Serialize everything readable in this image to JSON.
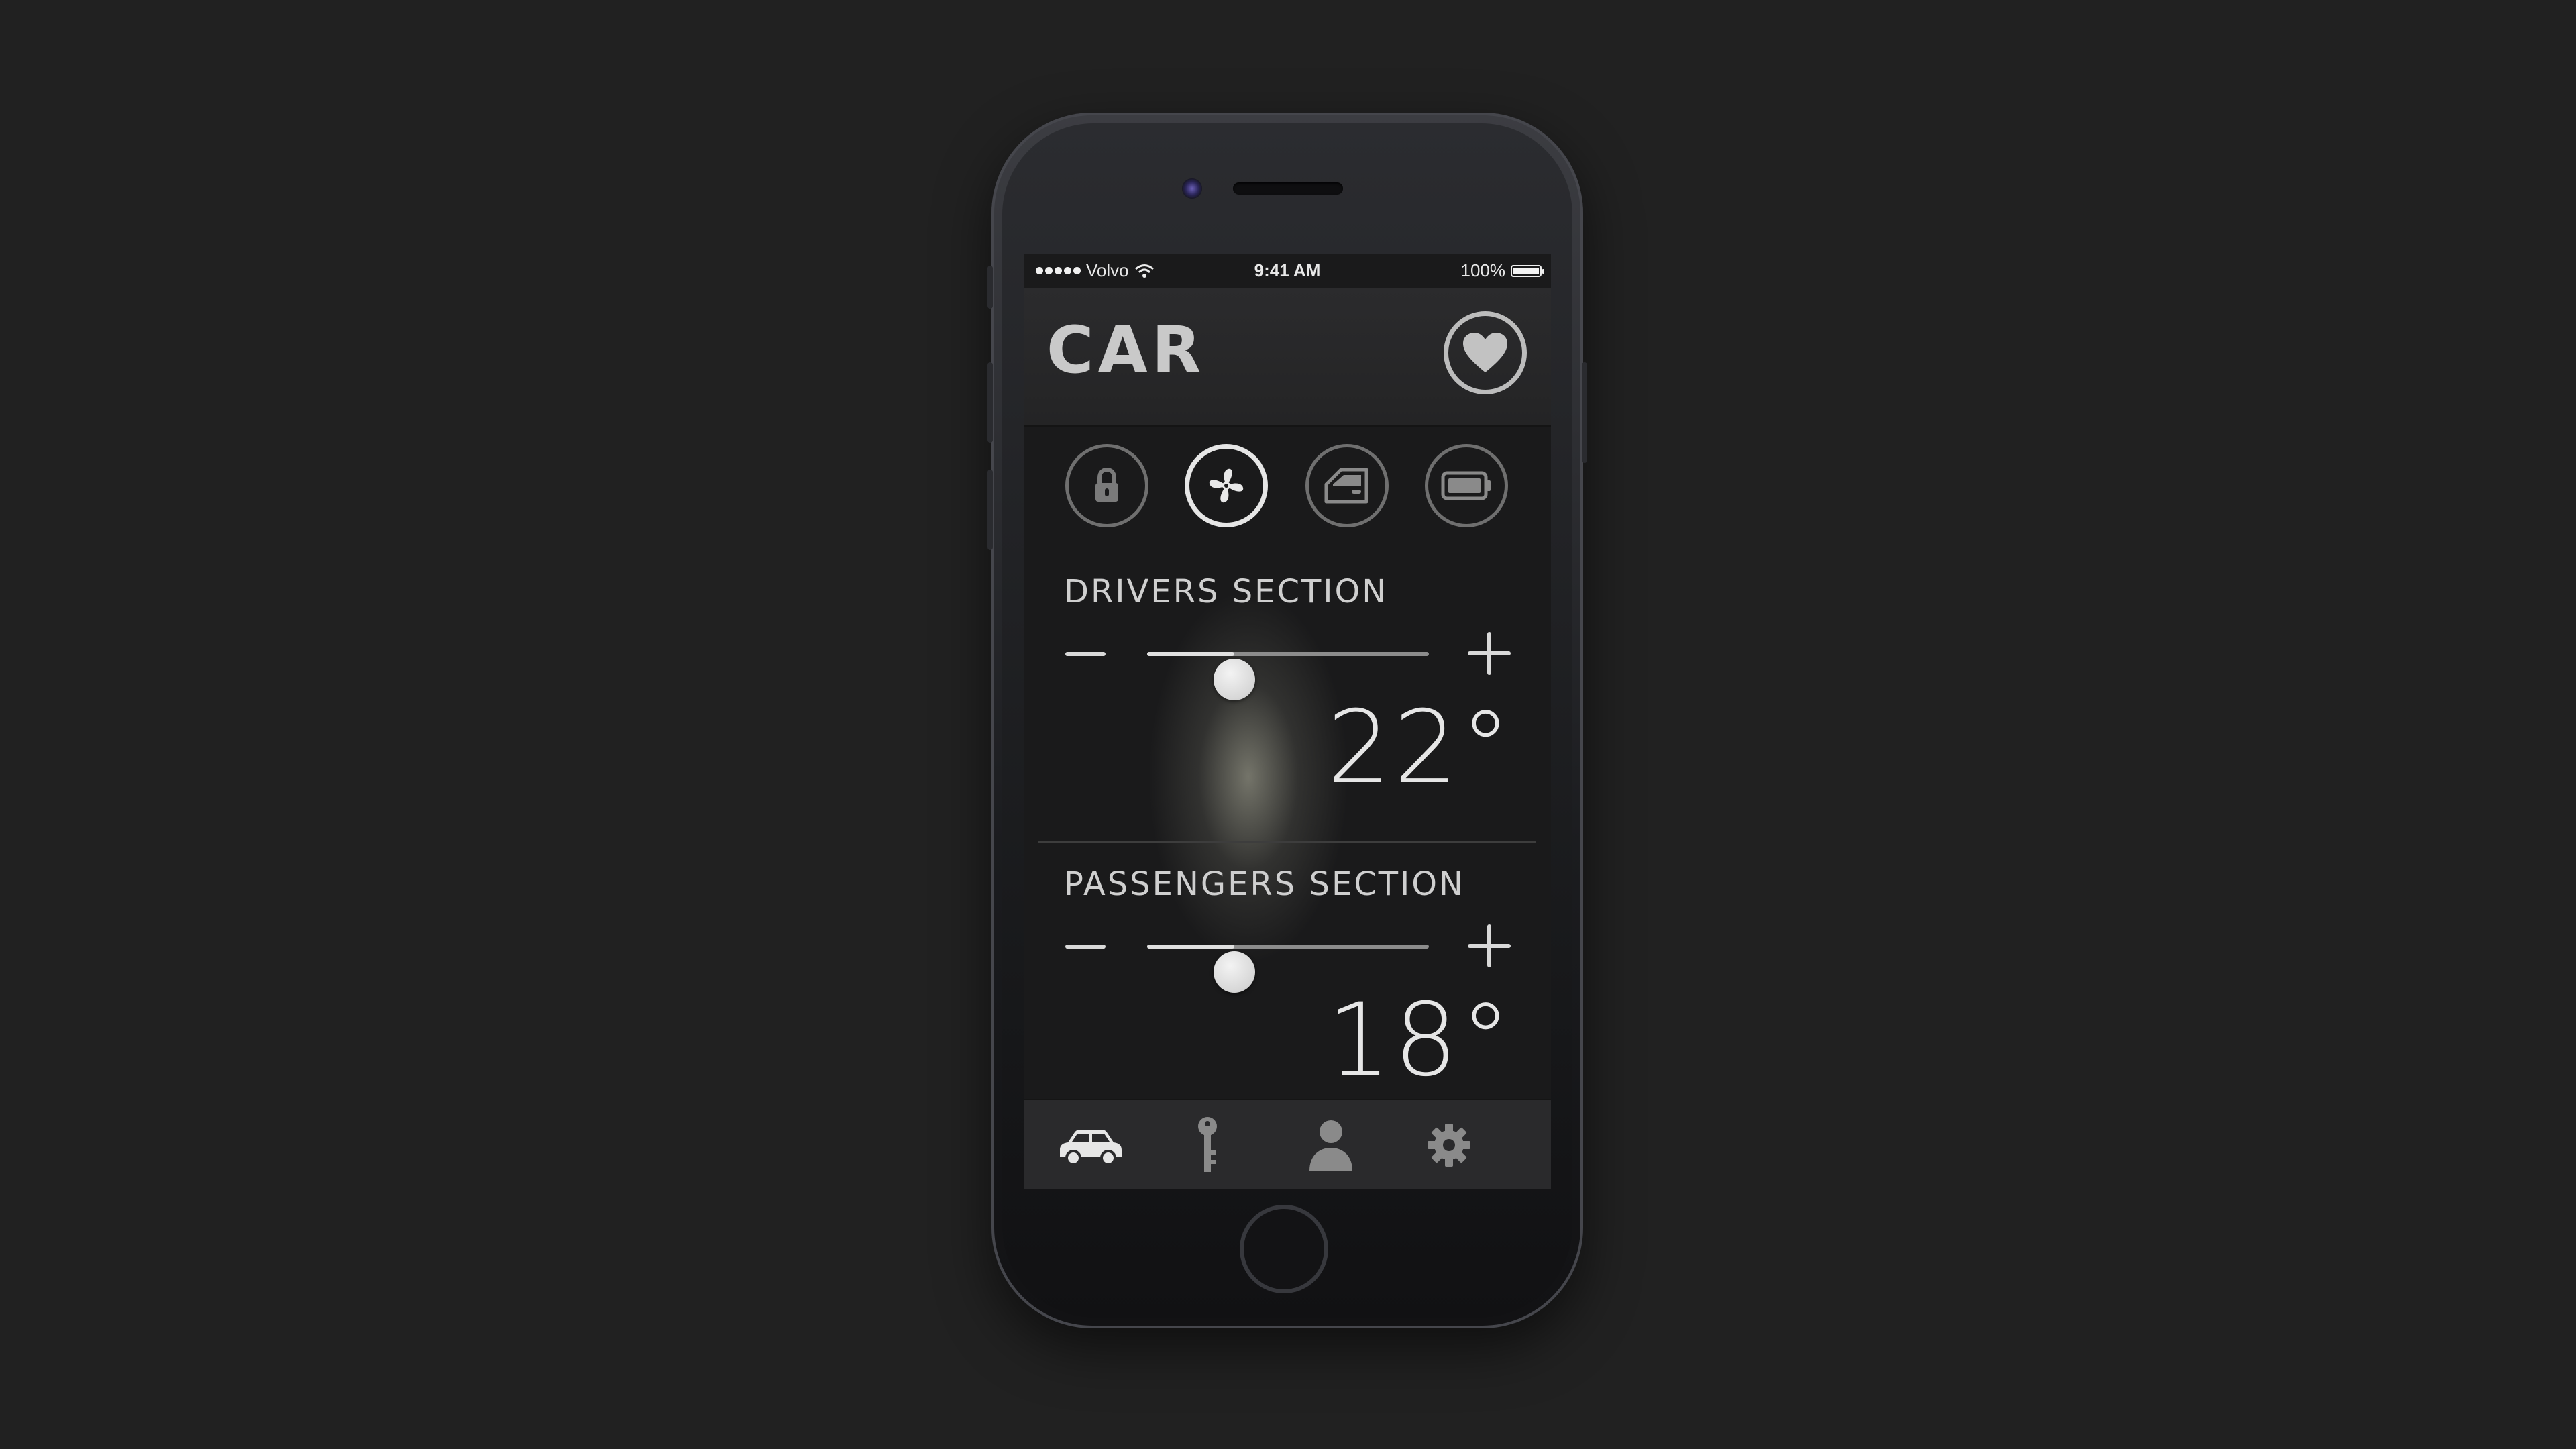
{
  "status_bar": {
    "carrier": "Volvo",
    "time": "9:41 AM",
    "battery": "100%",
    "signal_icon": "signal-dots-icon",
    "wifi_icon": "wifi-icon",
    "battery_icon": "battery-icon"
  },
  "header": {
    "title": "CAR",
    "favorite_icon": "heart-icon"
  },
  "quick_controls": [
    {
      "icon": "lock-icon",
      "active": false
    },
    {
      "icon": "fan-icon",
      "active": true
    },
    {
      "icon": "door-icon",
      "active": false
    },
    {
      "icon": "battery-icon",
      "active": false
    }
  ],
  "drivers": {
    "label": "DRIVERS SECTION",
    "temperature": "22°",
    "slider_level": 0.31
  },
  "passengers": {
    "label": "PASSENGERS SECTION",
    "temperature": "18°",
    "slider_level": 0.31
  },
  "tab_bar": [
    {
      "icon": "car-icon",
      "active": true
    },
    {
      "icon": "key-icon",
      "active": false
    },
    {
      "icon": "person-icon",
      "active": false
    },
    {
      "icon": "gear-icon",
      "active": false
    }
  ],
  "colors": {
    "background": "#212121",
    "screen": "#1a1a1b",
    "active_icon": "#e6e6e6",
    "inactive_icon": "#6f6f6f"
  }
}
